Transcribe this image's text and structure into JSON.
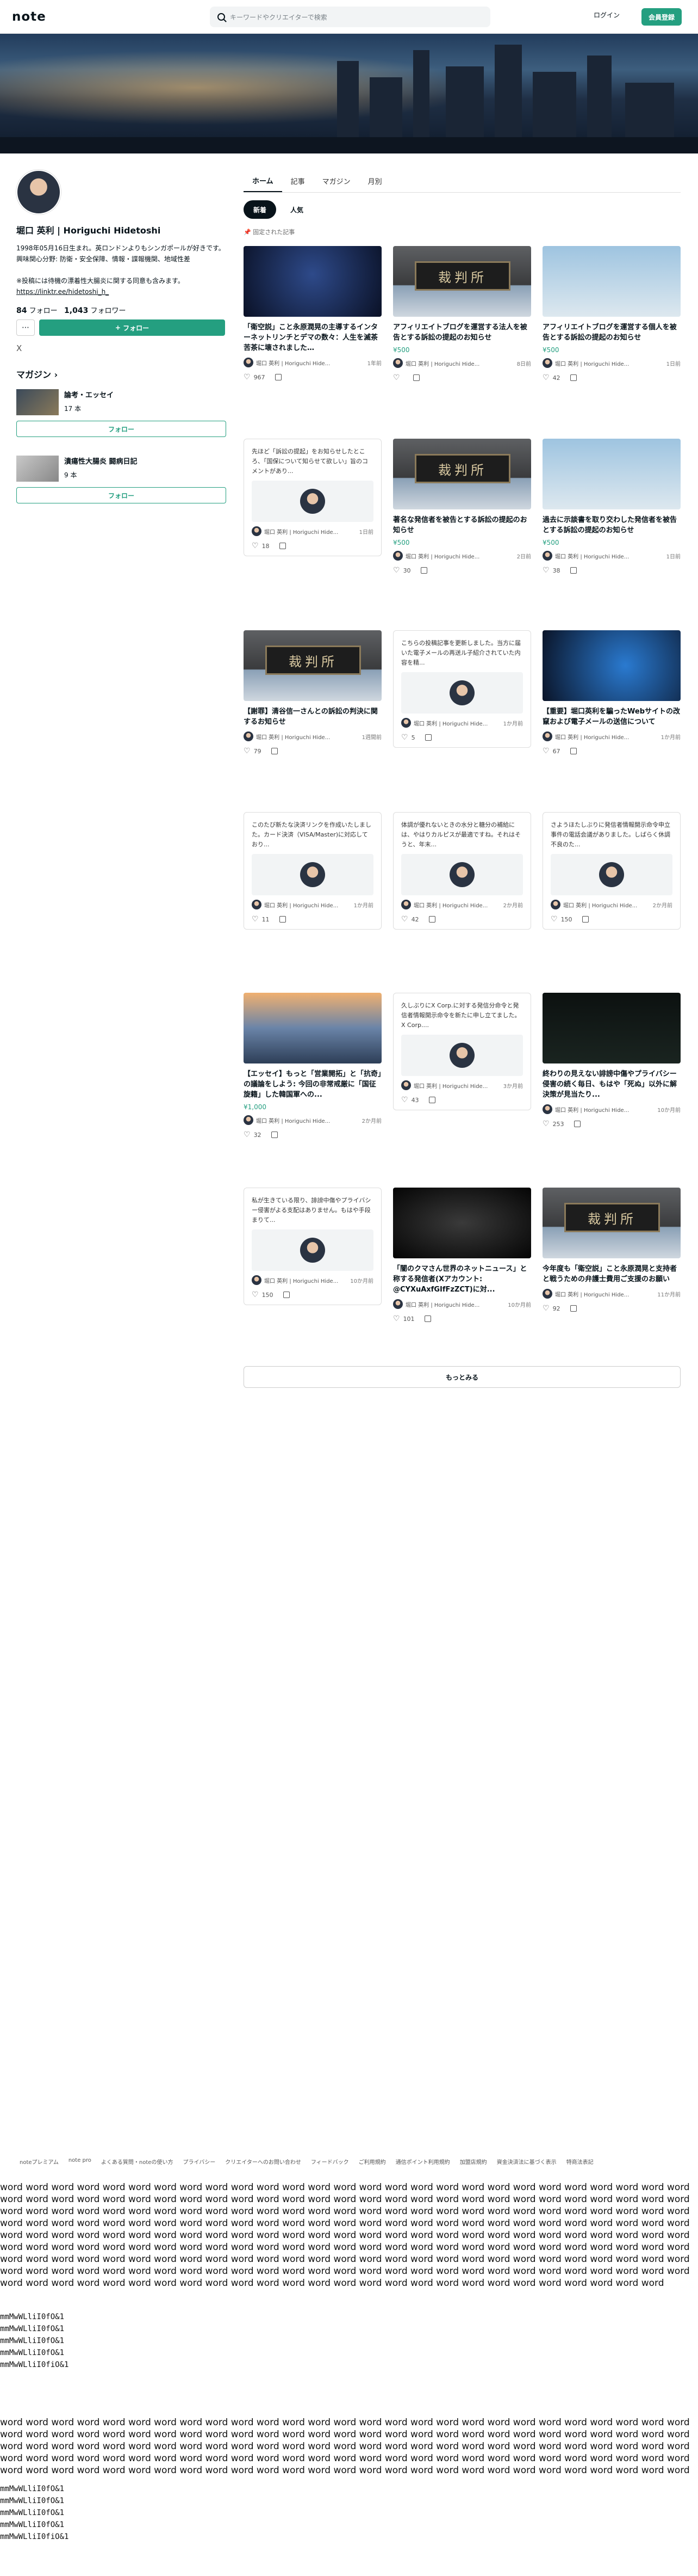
{
  "header": {
    "logo": "note",
    "search_placeholder": "キーワードやクリエイターで検索",
    "login_label": "ログイン",
    "signup_label": "会員登録"
  },
  "profile": {
    "name": "堀口 英利 | Horiguchi Hidetoshi",
    "bio": "1998年05月16日生まれ。英ロンドンよりもシンガポールが好きです。\n興味関心分野: 防衛・安全保障、情報・諜報機関、地域性差\n\n※投稿には待機の漂着性大腸炎に関する同意も含みます。",
    "link": "https://linktr.ee/hidetoshi_h_",
    "follow_count": "84",
    "follow_label": "フォロー",
    "follower_count": "1,043",
    "follower_label": "フォロワー",
    "more_icon": "ellipsis-icon",
    "follow_button": "フォロー",
    "x_icon": "X"
  },
  "magazines": {
    "heading": "マガジン",
    "items": [
      {
        "title": "論考・エッセイ",
        "count": "17 本",
        "follow": "フォロー"
      },
      {
        "title": "潰瘍性大腸炎 闘病日記",
        "count": "9 本",
        "follow": "フォロー"
      }
    ]
  },
  "tabs": [
    "ホーム",
    "記事",
    "マガジン",
    "月別"
  ],
  "pills": [
    "新着",
    "人気"
  ],
  "pinned_label": "固定された記事",
  "author": "堀口 英利 | Horiguchi Hidetoshi",
  "author_short": "堀口 英利 | Horiguchi Hide...",
  "articles": [
    {
      "title": "「衛空説」こと永原潤晃の主導するインターネットリンチとデマの数々：人生を滅茶苦茶に壊されました…",
      "time": "1年前",
      "likes": "967",
      "price": ""
    },
    {
      "title": "アフィリエイトブログを運営する法人を被告とする訴訟の提起のお知らせ",
      "time": "8日前",
      "likes": "",
      "price": "¥500"
    },
    {
      "title": "アフィリエイトブログを運営する個人を被告とする訴訟の提起のお知らせ",
      "time": "1日前",
      "likes": "42",
      "price": "¥500"
    },
    {
      "text": "先ほど「訴訟の提起」をお知らせしたところ、「国保について知らせて欲しい」旨のコメントがあり...",
      "time": "1日前",
      "likes": "18"
    },
    {
      "title": "著名な発信者を被告とする訴訟の提起のお知らせ",
      "time": "2日前",
      "likes": "30",
      "price": "¥500"
    },
    {
      "title": "過去に示談書を取り交わした発信者を被告とする訴訟の提起のお知らせ",
      "time": "1日前",
      "likes": "38",
      "price": "¥500"
    },
    {
      "title": "【謝罪】清谷信一さんとの訴訟の判決に関するお知らせ",
      "time": "1週間前",
      "likes": "79",
      "price": ""
    },
    {
      "text": "こちらの投稿記事を更新しました。当方に届いた電子メールの再送ル子紹介されていた内容を精...",
      "time": "1か月前",
      "likes": "5"
    },
    {
      "title": "【重要】堀口英利を騙ったWebサイトの改竄および電子メールの送信について",
      "time": "1か月前",
      "likes": "67",
      "price": ""
    },
    {
      "text": "このたび新たな決済リンクを作成いたしました。カード決済（VISA/Master)に対応しており...",
      "time": "1か月前",
      "likes": "11"
    },
    {
      "text": "体調が優れないときの水分と糖分の補給には、やはりカルピスが最適ですね。それはそうと、年末...",
      "time": "2か月前",
      "likes": "42"
    },
    {
      "text": "さようほたしぶりに発信者情報開示命令申立事件の電話会議がありました。しばらく休調不良のた...",
      "time": "2か月前",
      "likes": "150"
    },
    {
      "title": "【エッセイ】もっと「営業開拓」と「抗奇」の議論をしよう: 今回の非常戒厳に「国征旋籍」した韓国軍への...",
      "time": "2か月前",
      "likes": "32",
      "price": "¥1,000"
    },
    {
      "text": "久しぶりにX Corp.に対する発信分命令と発信者情報開示命令を新たに申し立てました。X Corp....",
      "time": "3か月前",
      "likes": "43"
    },
    {
      "title": "終わりの見えない誹謗中傷やプライバシー侵害の続く毎日、もはや「死ぬ」以外に解決策が見当たり...",
      "time": "10か月前",
      "likes": "253",
      "price": ""
    },
    {
      "text": "私が生きている限り、誹謗中傷やプライバシー侵害がよる支配はありません。もはや手段まりて...",
      "time": "10か月前",
      "likes": "150"
    },
    {
      "title": "「闇のクマさん世界のネットニュース」と称する発信者(Xアカウント: @CYXuAxfGIfFzZCT)に対...",
      "time": "10か月前",
      "likes": "101",
      "price": ""
    },
    {
      "title": "今年度も「衛空説」こと永原潤晃と支持者と戦うための弁護士費用ご支援のお願い",
      "time": "11か月前",
      "likes": "92",
      "price": ""
    }
  ],
  "more_label": "もっとみる",
  "footer": [
    "noteプレミアム",
    "note pro",
    "よくある質問・noteの使い方",
    "プライバシー",
    "クリエイターへのお問い合わせ",
    "フィードバック",
    "ご利用規約",
    "通信ポイント利用規約",
    "加盟店規約",
    "資金決済法に基づく表示",
    "特商法表記"
  ],
  "filler": {
    "word_block": "word word word word word word word word word word word word word word word word word word word word word word word word word word word word word word word word word word word word word word word word word word word word word word word word word word word word word word word word word word word word word word word word word word word word word word word word word word word word word word word word word word word word word word word word word word word word word word word word word word word word word word word word word word word word word word word word word word word word word word word word word word word word word word word word word word word word word word word word word word word word word word word word word word word word word word word word word word word word word word word word word word word word word word word word word word word word word word word word word word word word word word word word word word word word word word word word word word word word word word word word word word word word word word word word word word word word word word word word word word word word word word word word word word word word word word word word word word word word word word word word word word",
    "mono_block": "mmMwWLliI0fO&1\nmmMwWLliI0fO&1\nmmMwWLliI0fO&1\nmmMwWLliI0fO&1\nmmMwWLliI0fiO&1",
    "mono_block_b": "mmMwWLliI0fO&1\nmmMwWLliI0fO&1\nmmMwWLliI0fO&1\nmmMwWLliI0fO&1\nmmMwWLliI0fiO&1"
  }
}
